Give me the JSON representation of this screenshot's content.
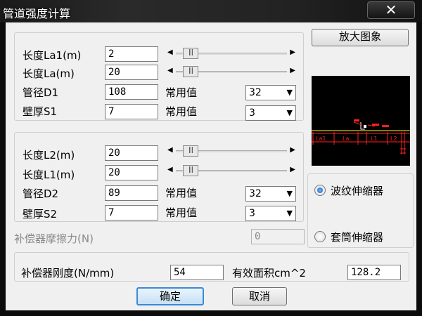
{
  "window": {
    "title": "管道强度计算",
    "close_glyph": "✕"
  },
  "group1": {
    "rows": [
      {
        "label": "长度La1(m)",
        "value": "2"
      },
      {
        "label": "长度La(m)",
        "value": "20"
      },
      {
        "label": "管径D1",
        "value": "108",
        "common_label": "常用值",
        "combo": "32"
      },
      {
        "label": "壁厚S1",
        "value": "7",
        "common_label": "常用值",
        "combo": "3"
      }
    ]
  },
  "group2": {
    "rows": [
      {
        "label": "长度L2(m)",
        "value": "20"
      },
      {
        "label": "长度L1(m)",
        "value": "20"
      },
      {
        "label": "管径D2",
        "value": "89",
        "common_label": "常用值",
        "combo": "32"
      },
      {
        "label": "壁厚S2",
        "value": "7",
        "common_label": "常用值",
        "combo": "3"
      }
    ]
  },
  "friction": {
    "label": "补偿器摩擦力(N)",
    "value": "0"
  },
  "zoom_button": "放大图象",
  "preview": {
    "labels": [
      "La1",
      "La",
      "L1",
      "L2"
    ]
  },
  "radios": {
    "bellows": "波纹伸缩器",
    "sleeve": "套筒伸缩器",
    "selected": "bellows"
  },
  "stiffness": {
    "label": "补偿器刚度(N/mm)",
    "value": "54",
    "area_label": "有效面积cm^2",
    "area_value": "128.2"
  },
  "buttons": {
    "ok": "确定",
    "cancel": "取消"
  },
  "colors": {
    "drawing_red": "#ff2020",
    "drawing_yellow": "#ffff00",
    "radio_accent": "#1463b8"
  }
}
